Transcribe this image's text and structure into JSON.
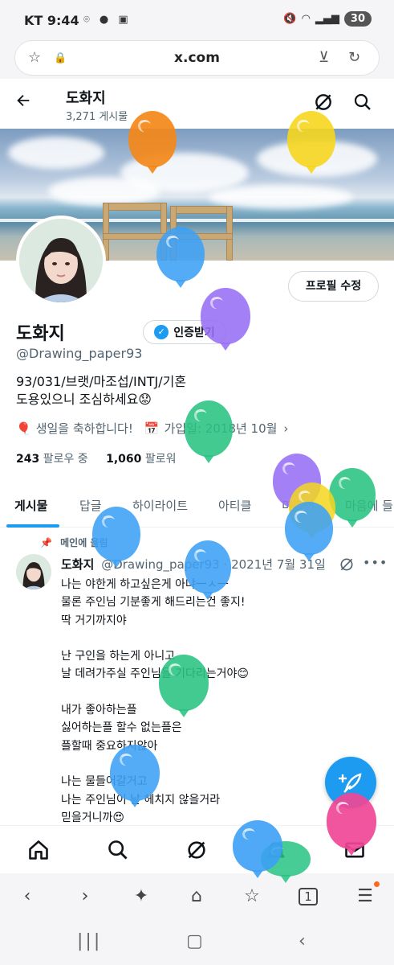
{
  "status_bar": {
    "carrier": "KT",
    "time": "9:44",
    "battery": "30"
  },
  "browser": {
    "url": "x.com"
  },
  "header": {
    "name": "도화지",
    "post_count": "3,271 게시물"
  },
  "profile": {
    "edit_button": "프로필 수정",
    "name": "도화지",
    "verify_button": "인증받기",
    "handle": "@Drawing_paper93",
    "bio_line1": "93/031/브랫/마조섭/INTJ/기혼",
    "bio_line2": "도용있으니 조심하세요😟",
    "birthday": "생일을 축하합니다!",
    "joined": "가입일: 2018년 10월",
    "following_count": "243",
    "following_label": "팔로우 중",
    "followers_count": "1,060",
    "followers_label": "팔로워"
  },
  "tabs": [
    "게시물",
    "답글",
    "하이라이트",
    "아티클",
    "미디어",
    "마음에 들"
  ],
  "tweet": {
    "pinned_label": "메인에 올림",
    "name": "도화지",
    "handle_date": "@Drawing_paper93 · 2021년 7월 31일",
    "body": "나는 야한게 하고싶은게 아냐一ㅅ一\n물론 주인님 기분좋게 해드리는건 좋지!\n딱 거기까지야\n\n난 구인을 하는게 아니고\n날 데려가주실 주인님을 기다리는거야😊\n\n내가 좋아하는플\n싫어하는플 할수 없는플은\n플할때 중요하지않아\n\n나는 물들어갈거고\n나는 주인님이 날 헤치지 않을거라\n믿을거니까😍"
  },
  "colors": {
    "accent": "#1d9bf0",
    "text": "#0f1419",
    "secondary": "#536471"
  },
  "icons": {
    "back": "arrow-left-icon",
    "grok": "grok-icon",
    "search": "search-icon",
    "compose": "feather-plus-icon",
    "home": "home-icon",
    "explore": "search-icon",
    "notifications": "bell-icon",
    "messages": "envelope-icon"
  }
}
